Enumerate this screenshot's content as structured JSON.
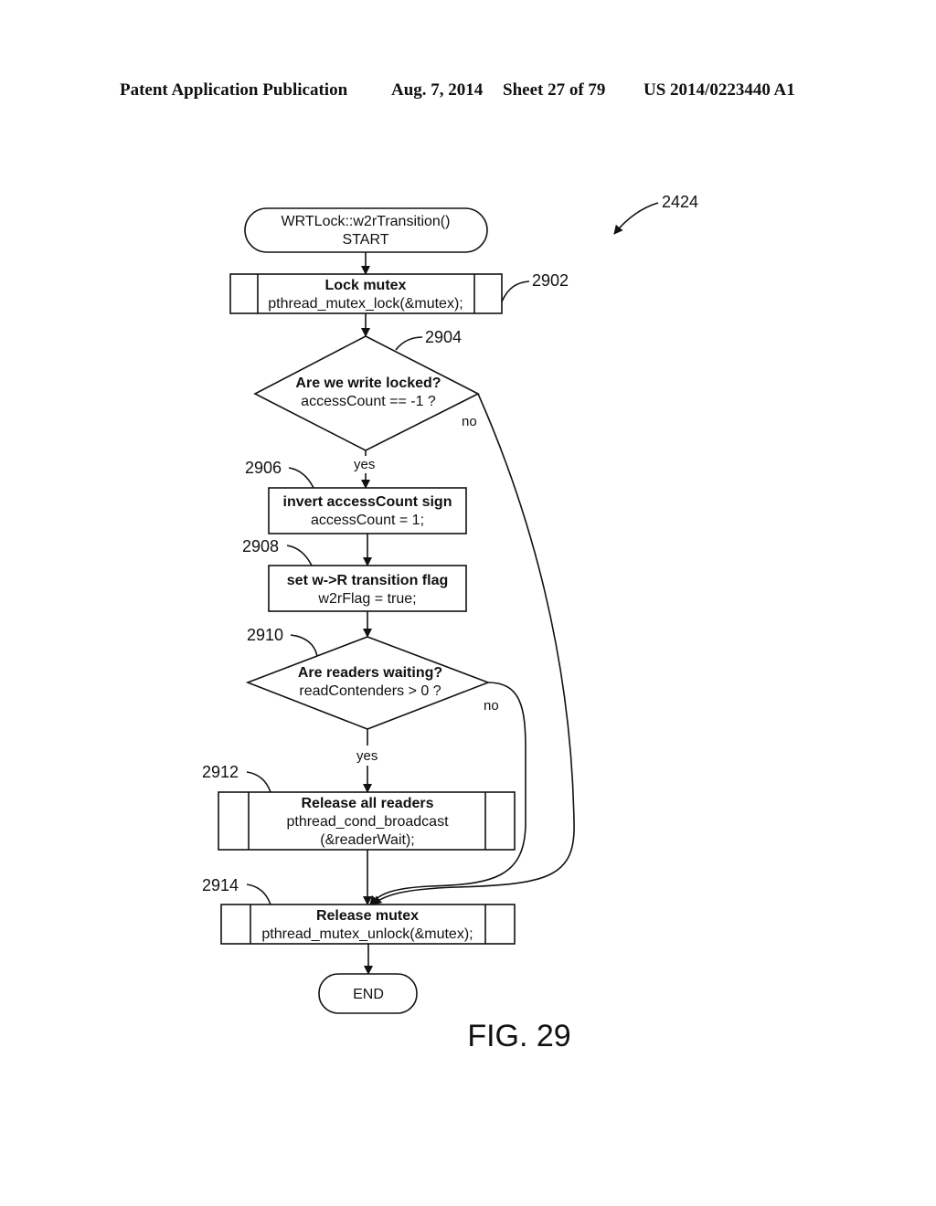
{
  "header": {
    "publication": "Patent Application Publication",
    "date": "Aug. 7, 2014",
    "sheet": "Sheet 27 of 79",
    "number": "US 2014/0223440 A1"
  },
  "figure": {
    "label": "FIG. 29",
    "ref": "2424"
  },
  "nodes": {
    "start": {
      "line1": "WRTLock::w2rTransition()",
      "line2": "START"
    },
    "lock_mutex": {
      "ref": "2902",
      "title": "Lock mutex",
      "code": "pthread_mutex_lock(&mutex);"
    },
    "write_locked": {
      "ref": "2904",
      "title": "Are we write locked?",
      "code": "accessCount == -1 ?"
    },
    "invert": {
      "ref": "2906",
      "title": "invert accessCount sign",
      "code": "accessCount = 1;"
    },
    "set_flag": {
      "ref": "2908",
      "title": "set w->R transition flag",
      "code": "w2rFlag = true;"
    },
    "readers_waiting": {
      "ref": "2910",
      "title": "Are readers waiting?",
      "code": "readContenders > 0 ?"
    },
    "release_readers": {
      "ref": "2912",
      "title": "Release all readers",
      "code1": "pthread_cond_broadcast",
      "code2": "(&readerWait);"
    },
    "release_mutex": {
      "ref": "2914",
      "title": "Release mutex",
      "code": "pthread_mutex_unlock(&mutex);"
    },
    "end": {
      "label": "END"
    }
  },
  "edges": {
    "yes": "yes",
    "no": "no"
  }
}
